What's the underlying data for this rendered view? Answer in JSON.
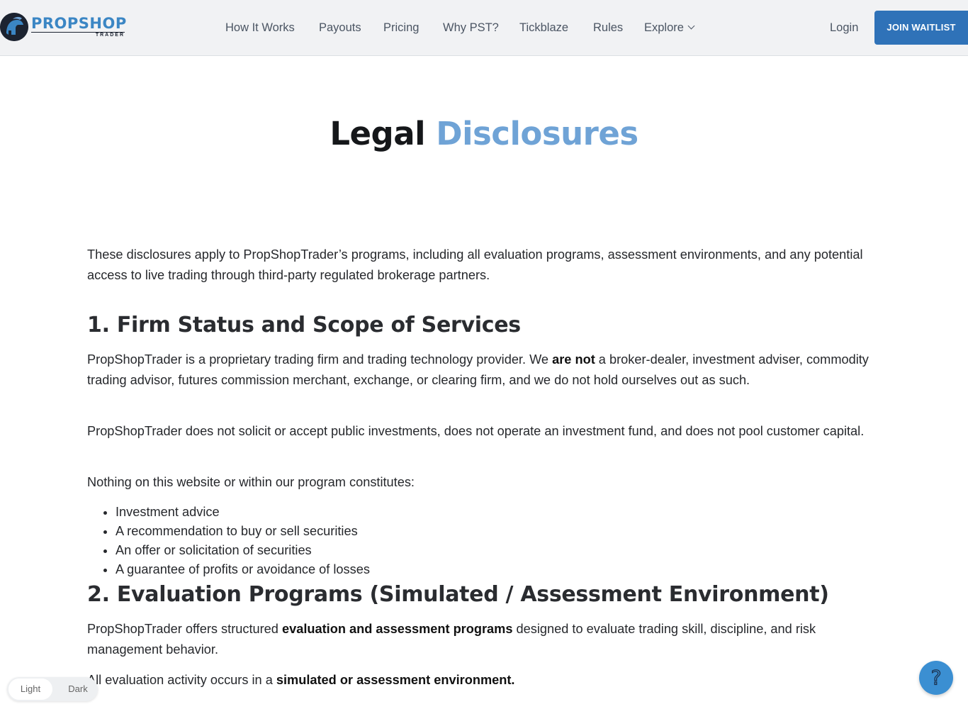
{
  "brand": {
    "name": "PROPSHOP",
    "sub": "TRADER"
  },
  "nav": {
    "items": [
      "How It Works",
      "Payouts",
      "Pricing",
      "Why PST?",
      "Tickblaze",
      "Rules",
      "Explore"
    ],
    "login": "Login",
    "join": "JOIN WAITLIST"
  },
  "page": {
    "title_a": "Legal",
    "title_b": "Disclosures",
    "intro": "These disclosures apply to PropShopTrader’s programs, including all evaluation programs, assessment environments, and any potential access to live trading through third-party regulated brokerage partners.",
    "s1": {
      "heading": "1. Firm Status and Scope of Services",
      "p1_a": "PropShopTrader is a proprietary trading firm and trading technology provider. We ",
      "p1_b": "are not",
      "p1_c": " a broker-dealer, investment adviser, commodity trading advisor, futures commission merchant, exchange, or clearing firm, and we do not hold ourselves out as such.",
      "p2": "PropShopTrader does not solicit or accept public investments, does not operate an investment fund, and does not pool customer capital.",
      "p3": "Nothing on this website or within our program constitutes:",
      "bullets": [
        "Investment advice",
        "A recommendation to buy or sell securities",
        "An offer or solicitation of securities",
        "A guarantee of profits or avoidance of losses"
      ]
    },
    "s2": {
      "heading": "2. Evaluation Programs (Simulated / Assessment Environment)",
      "p1_a": "PropShopTrader offers structured ",
      "p1_b": "evaluation and assessment programs",
      "p1_c": " designed to evaluate trading skill, discipline, and risk management behavior.",
      "p2_a": "All evaluation activity occurs in a ",
      "p2_b": "simulated or assessment environment."
    }
  },
  "theme": {
    "light": "Light",
    "dark": "Dark"
  },
  "help": {
    "icon": "question-mark-icon",
    "glyph": "?"
  },
  "colors": {
    "accent": "#2f72b8",
    "title_accent": "#6fa3d6",
    "help": "#3b8fd2"
  }
}
